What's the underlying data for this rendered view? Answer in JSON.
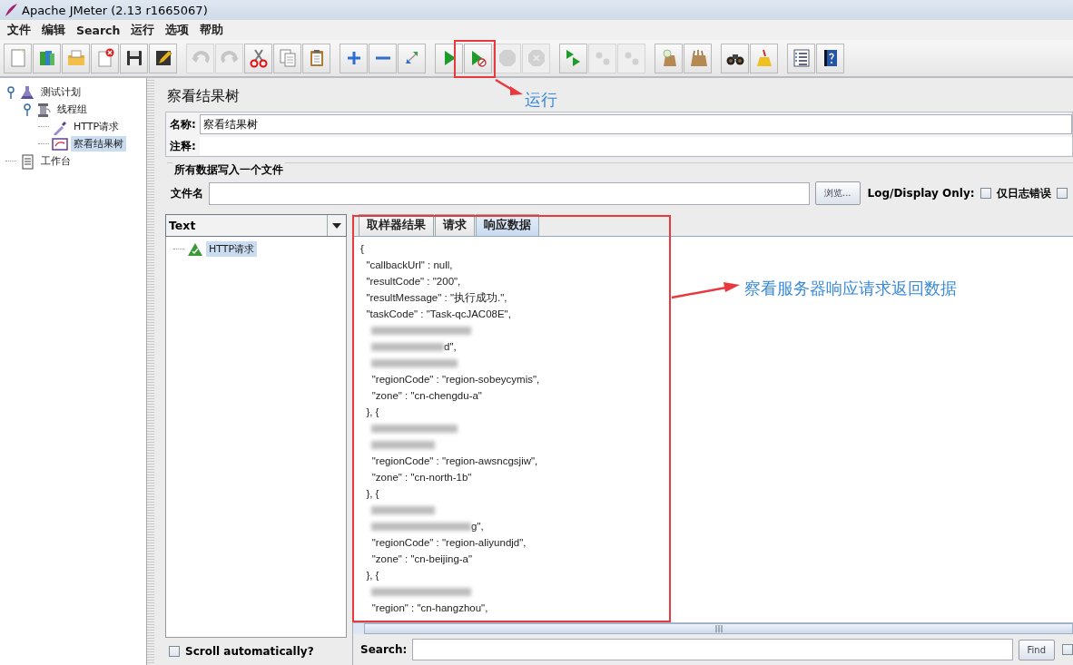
{
  "window": {
    "title": "Apache JMeter (2.13 r1665067)"
  },
  "menu": [
    "文件",
    "编辑",
    "Search",
    "运行",
    "选项",
    "帮助"
  ],
  "toolbar": [
    {
      "items": [
        {
          "kind": "new",
          "disabled": false
        },
        {
          "kind": "templates",
          "disabled": false
        },
        {
          "kind": "open",
          "disabled": false
        },
        {
          "kind": "close",
          "disabled": false
        },
        {
          "kind": "save",
          "disabled": false
        },
        {
          "kind": "saveas",
          "disabled": false
        }
      ]
    },
    {
      "items": [
        {
          "kind": "undo",
          "disabled": true
        },
        {
          "kind": "redo",
          "disabled": true
        },
        {
          "kind": "cut",
          "disabled": false
        },
        {
          "kind": "copy",
          "disabled": false
        },
        {
          "kind": "paste",
          "disabled": false
        }
      ]
    },
    {
      "items": [
        {
          "kind": "expand",
          "disabled": false
        },
        {
          "kind": "collapse",
          "disabled": false
        },
        {
          "kind": "toggle",
          "disabled": false
        }
      ]
    },
    {
      "items": [
        {
          "kind": "start",
          "disabled": false
        },
        {
          "kind": "start_no_pause",
          "disabled": false
        },
        {
          "kind": "stop",
          "disabled": true
        },
        {
          "kind": "shutdown",
          "disabled": true
        }
      ]
    },
    {
      "items": [
        {
          "kind": "remote_start",
          "disabled": false
        },
        {
          "kind": "remote_stop",
          "disabled": true
        },
        {
          "kind": "remote_exit",
          "disabled": true
        }
      ]
    },
    {
      "items": [
        {
          "kind": "clear",
          "disabled": false
        },
        {
          "kind": "clear_all",
          "disabled": false
        }
      ]
    },
    {
      "items": [
        {
          "kind": "search",
          "disabled": false
        },
        {
          "kind": "reset_search",
          "disabled": false
        }
      ]
    },
    {
      "items": [
        {
          "kind": "function",
          "disabled": false
        },
        {
          "kind": "help",
          "disabled": false
        }
      ]
    }
  ],
  "test_tree": [
    {
      "label": "测试计划",
      "kind": "plan",
      "selected": false,
      "expanded": true,
      "children": [
        {
          "label": "线程组",
          "kind": "threads",
          "selected": false,
          "expanded": true,
          "children": [
            {
              "label": "HTTP请求",
              "kind": "sampler",
              "selected": false
            },
            {
              "label": "察看结果树",
              "kind": "listener",
              "selected": true
            }
          ]
        }
      ]
    },
    {
      "label": "工作台",
      "kind": "workbench",
      "selected": false
    }
  ],
  "viewer": {
    "title": "察看结果树",
    "name_label": "名称:",
    "name_value": "察看结果树",
    "comment_label": "注释:",
    "file_section": "所有数据写入一个文件",
    "file_label": "文件名",
    "browse": "浏览...",
    "log_label": "Log/Display Only:",
    "log_options": [
      {
        "label": "仅日志错误",
        "checked": false
      },
      {
        "checked": false
      }
    ],
    "renderer": "Text",
    "results": [
      {
        "label": "HTTP请求",
        "kind": "success",
        "selected": true
      }
    ],
    "scroll_auto": {
      "label": "Scroll automatically?",
      "checked": false
    },
    "tabs": [
      {
        "label": "取样器结果",
        "selected": false
      },
      {
        "label": "请求",
        "selected": false
      },
      {
        "label": "响应数据",
        "selected": true
      }
    ],
    "response_lines": [
      {
        "text": "{",
        "redacted": false
      },
      {
        "text": "  \"callbackUrl\" : null,",
        "redacted": false
      },
      {
        "text": "  \"resultCode\" : \"200\",",
        "redacted": false
      },
      {
        "text": "  \"resultMessage\" : \"执行成功.\",",
        "redacted": false
      },
      {
        "text": "  \"taskCode\" : \"Task-qcJAC08E\",",
        "redacted": false
      },
      {
        "redacted": true
      },
      {
        "text": "d\",",
        "redacted": true
      },
      {
        "redacted": true
      },
      {
        "text": "    \"regionCode\" : \"region-sobeycymis\",",
        "redacted": false
      },
      {
        "text": "    \"zone\" : \"cn-chengdu-a\"",
        "redacted": false
      },
      {
        "text": "  }, {",
        "redacted": false
      },
      {
        "redacted": true
      },
      {
        "redacted": true
      },
      {
        "text": "    \"regionCode\" : \"region-awsncgsjiw\",",
        "redacted": false
      },
      {
        "text": "    \"zone\" : \"cn-north-1b\"",
        "redacted": false
      },
      {
        "text": "  }, {",
        "redacted": false
      },
      {
        "redacted": true
      },
      {
        "text": "g\",",
        "redacted": true
      },
      {
        "text": "    \"regionCode\" : \"region-aliyundjd\",",
        "redacted": false
      },
      {
        "text": "    \"zone\" : \"cn-beijing-a\"",
        "redacted": false
      },
      {
        "text": "  }, {",
        "redacted": false
      },
      {
        "redacted": true
      },
      {
        "text": "    \"region\" : \"cn-hangzhou\",",
        "redacted": false
      }
    ],
    "search": {
      "label": "Search:",
      "button": "Find",
      "options": [
        {
          "checked": false
        }
      ]
    }
  },
  "callouts": [
    {
      "kind": "run",
      "text": "运行"
    },
    {
      "kind": "response",
      "text": "察看服务器响应请求返回数据"
    }
  ]
}
